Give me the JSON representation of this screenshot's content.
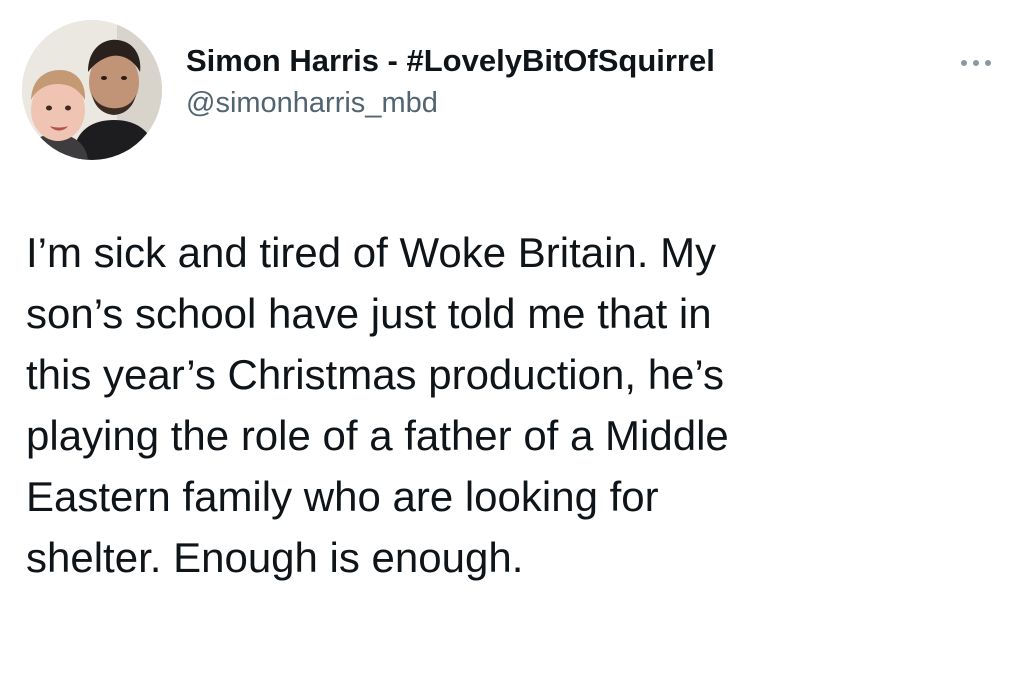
{
  "tweet": {
    "author": {
      "display_name": "Simon Harris - #LovelyBitOfSquirrel",
      "handle": "@simonharris_mbd"
    },
    "more_icon": "more-horizontal-icon",
    "text_lines": [
      "I’m sick and tired of Woke Britain. My",
      "son’s school have just told me that in",
      "this year’s Christmas production, he’s",
      "playing the role of a father of a Middle",
      "Eastern family who are looking for",
      "shelter. Enough is enough."
    ]
  },
  "colors": {
    "text_primary": "#0f1419",
    "text_secondary": "#536471",
    "background": "#ffffff"
  }
}
